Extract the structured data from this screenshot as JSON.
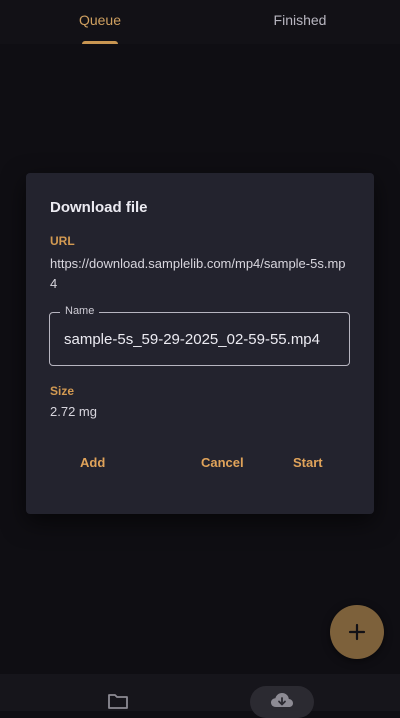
{
  "tabs": [
    {
      "label": "Queue",
      "active": true
    },
    {
      "label": "Finished",
      "active": false
    }
  ],
  "dialog": {
    "title": "Download file",
    "url_label": "URL",
    "url_value": "https://download.samplelib.com/mp4/sample-5s.mp4",
    "name_label": "Name",
    "name_value": "sample-5s_59-29-2025_02-59-55.mp4",
    "size_label": "Size",
    "size_value": "2.72 mg",
    "buttons": {
      "add": "Add",
      "cancel": "Cancel",
      "start": "Start"
    }
  },
  "fab": {
    "icon": "plus-icon"
  },
  "bottom_nav": [
    {
      "icon": "folder-icon",
      "active": false
    },
    {
      "icon": "cloud-download-icon",
      "active": true
    }
  ],
  "colors": {
    "accent": "#d39a52",
    "dialog_bg": "#23232e",
    "background": "#0f0e13"
  }
}
